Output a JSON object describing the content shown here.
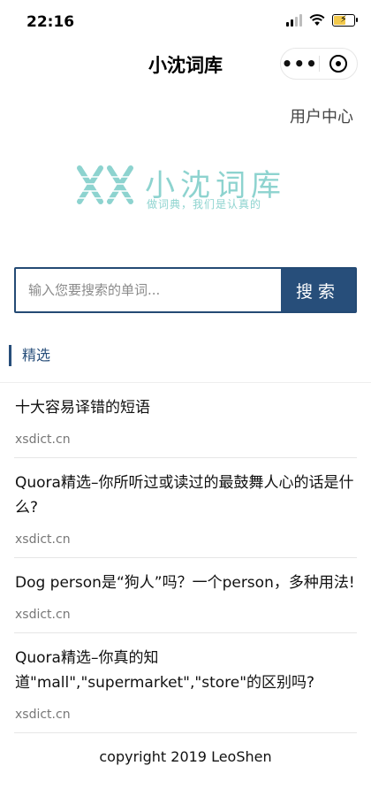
{
  "status_bar": {
    "time": "22:16"
  },
  "nav": {
    "title": "小沈词库"
  },
  "header": {
    "user_center": "用户中心"
  },
  "logo": {
    "title": "小沈词库",
    "tagline": "做词典，我们是认真的"
  },
  "search": {
    "placeholder": "输入您要搜索的单词...",
    "button_label": "搜索"
  },
  "section": {
    "title": "精选"
  },
  "articles": [
    {
      "title": "十大容易译错的短语",
      "source": "xsdict.cn"
    },
    {
      "title": "Quora精选–你所听过或读过的最鼓舞人心的话是什么?",
      "source": "xsdict.cn"
    },
    {
      "title": "Dog person是“狗人”吗？一个person，多种用法!",
      "source": "xsdict.cn"
    },
    {
      "title": "Quora精选–你真的知道\"mall\",\"supermarket\",\"store\"的区别吗?",
      "source": "xsdict.cn"
    }
  ],
  "footer": {
    "copyright": "copyright 2019 LeoShen"
  },
  "colors": {
    "primary": "#274e7a",
    "logo": "#8dd3cf"
  }
}
